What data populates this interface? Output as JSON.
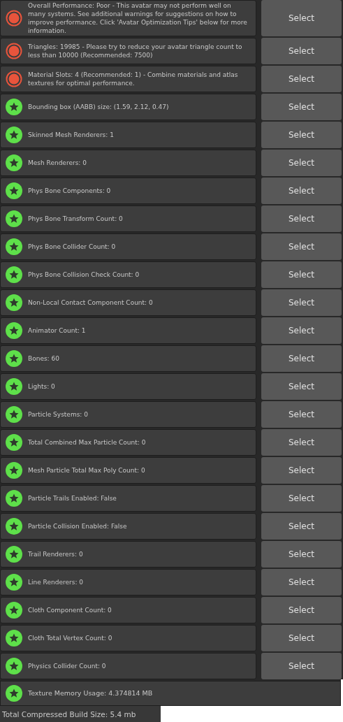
{
  "checks": [
    {
      "kind": "poor",
      "text": "Overall Performance: Poor - This avatar may not perform well on many systems. See additional warnings for suggestions on how to improve performance. Click 'Avatar Optimization Tips' below for more information.",
      "button": "Select"
    },
    {
      "kind": "poor",
      "text": "Triangles: 19985 - Please try to reduce your avatar triangle count to less than 10000 (Recommended: 7500)",
      "button": "Select"
    },
    {
      "kind": "poor",
      "text": "Material Slots: 4 (Recommended: 1) - Combine materials and atlas textures for optimal performance.",
      "button": "Select"
    },
    {
      "kind": "excellent",
      "text": "Bounding box (AABB) size: (1.59, 2.12, 0.47)",
      "button": "Select"
    },
    {
      "kind": "excellent",
      "text": "Skinned Mesh Renderers: 1",
      "button": "Select"
    },
    {
      "kind": "excellent",
      "text": "Mesh Renderers: 0",
      "button": "Select"
    },
    {
      "kind": "excellent",
      "text": "Phys Bone Components: 0",
      "button": "Select"
    },
    {
      "kind": "excellent",
      "text": "Phys Bone Transform Count: 0",
      "button": "Select"
    },
    {
      "kind": "excellent",
      "text": "Phys Bone Collider Count: 0",
      "button": "Select"
    },
    {
      "kind": "excellent",
      "text": "Phys Bone Collision Check Count: 0",
      "button": "Select"
    },
    {
      "kind": "excellent",
      "text": "Non-Local Contact Component Count: 0",
      "button": "Select"
    },
    {
      "kind": "excellent",
      "text": "Animator Count: 1",
      "button": "Select"
    },
    {
      "kind": "excellent",
      "text": "Bones: 60",
      "button": "Select"
    },
    {
      "kind": "excellent",
      "text": "Lights: 0",
      "button": "Select"
    },
    {
      "kind": "excellent",
      "text": "Particle Systems: 0",
      "button": "Select"
    },
    {
      "kind": "excellent",
      "text": "Total Combined Max Particle Count: 0",
      "button": "Select"
    },
    {
      "kind": "excellent",
      "text": "Mesh Particle Total Max Poly Count: 0",
      "button": "Select"
    },
    {
      "kind": "excellent",
      "text": "Particle Trails Enabled: False",
      "button": "Select"
    },
    {
      "kind": "excellent",
      "text": "Particle Collision Enabled: False",
      "button": "Select"
    },
    {
      "kind": "excellent",
      "text": "Trail Renderers: 0",
      "button": "Select"
    },
    {
      "kind": "excellent",
      "text": "Line Renderers: 0",
      "button": "Select"
    },
    {
      "kind": "excellent",
      "text": "Cloth Component Count: 0",
      "button": "Select"
    },
    {
      "kind": "excellent",
      "text": "Cloth Total Vertex Count: 0",
      "button": "Select"
    },
    {
      "kind": "excellent",
      "text": "Physics Collider Count: 0",
      "button": "Select"
    }
  ],
  "texture_memory": {
    "kind": "excellent",
    "text": "Texture Memory Usage: 4.374814 MB"
  },
  "build_size": "Total Compressed Build Size: 5.4 mb"
}
